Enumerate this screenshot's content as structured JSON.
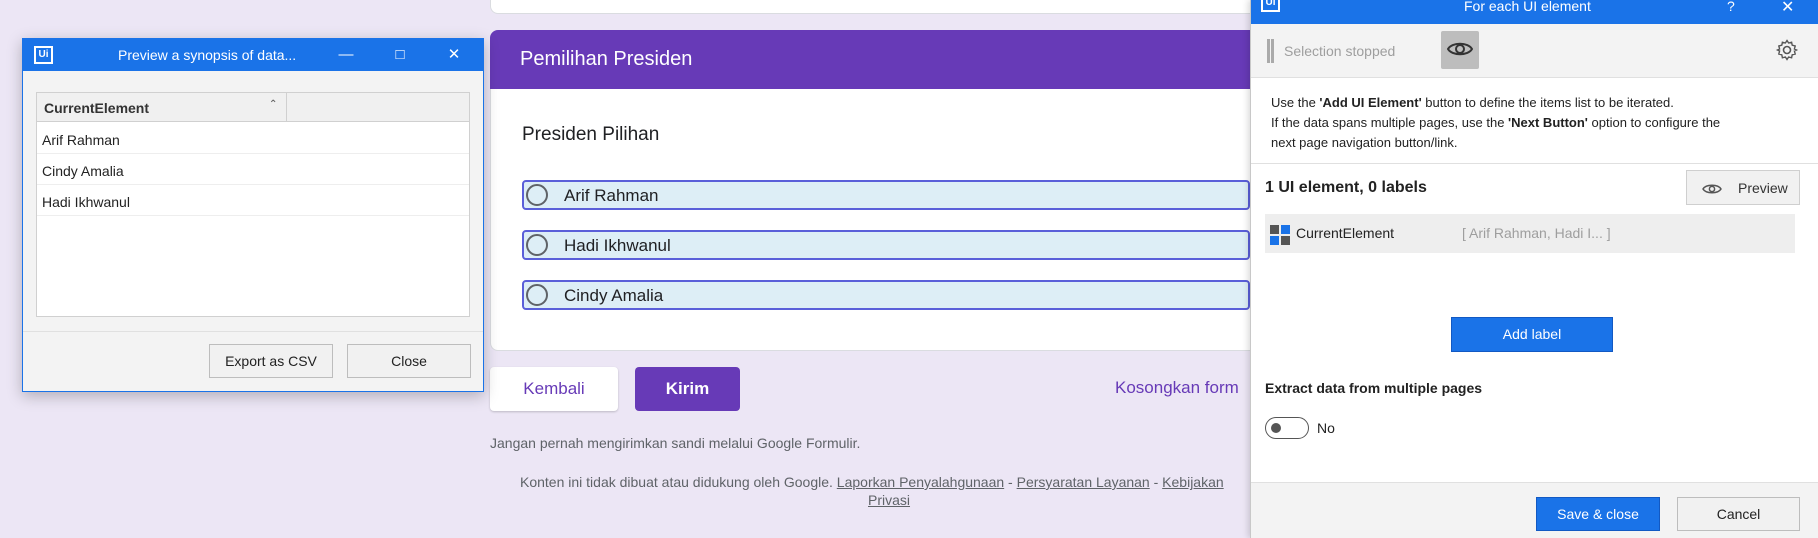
{
  "form": {
    "section_title": "Pemilihan Presiden",
    "question_title": "Presiden Pilihan",
    "options": [
      "Arif Rahman",
      "Hadi Ikhwanul",
      "Cindy Amalia"
    ],
    "back_label": "Kembali",
    "submit_label": "Kirim",
    "clear_label": "Kosongkan form",
    "note": "Jangan pernah mengirimkan sandi melalui Google Formulir.",
    "footer": {
      "prefix": "Konten ini tidak dibuat atau didukung oleh Google.",
      "report": "Laporkan Penyalahgunaan",
      "sep": " - ",
      "terms": "Persyaratan Layanan",
      "privacy_a": "Kebijakan",
      "privacy_b": "Privasi"
    },
    "accent_color": "#673ab7"
  },
  "preview_dialog": {
    "logo": "Ui",
    "title": "Preview a synopsis of data...",
    "column_header": "CurrentElement",
    "rows": [
      "Arif Rahman",
      "Cindy Amalia",
      "Hadi Ikhwanul"
    ],
    "export_label": "Export as CSV",
    "close_label": "Close"
  },
  "panel": {
    "logo": "Ui",
    "title": "For each UI element",
    "help": "?",
    "selection_status": "Selection stopped",
    "desc": {
      "l1a": "Use the ",
      "l1b": "'Add UI Element'",
      "l1c": " button to define the items list to be iterated.",
      "l2a": "If the data spans multiple pages, use the ",
      "l2b": "'Next Button'",
      "l2c": " option to configure the",
      "l3": "next page navigation button/link."
    },
    "count_text": "1 UI element, 0 labels",
    "preview_label": "Preview",
    "element_name": "CurrentElement",
    "element_preview": "[ Arif Rahman, Hadi I...   ]",
    "add_label": "Add label",
    "multi_pages_label": "Extract data from multiple pages",
    "toggle_value": "No",
    "save_label": "Save & close",
    "cancel_label": "Cancel",
    "accent_color": "#1a73e8"
  }
}
